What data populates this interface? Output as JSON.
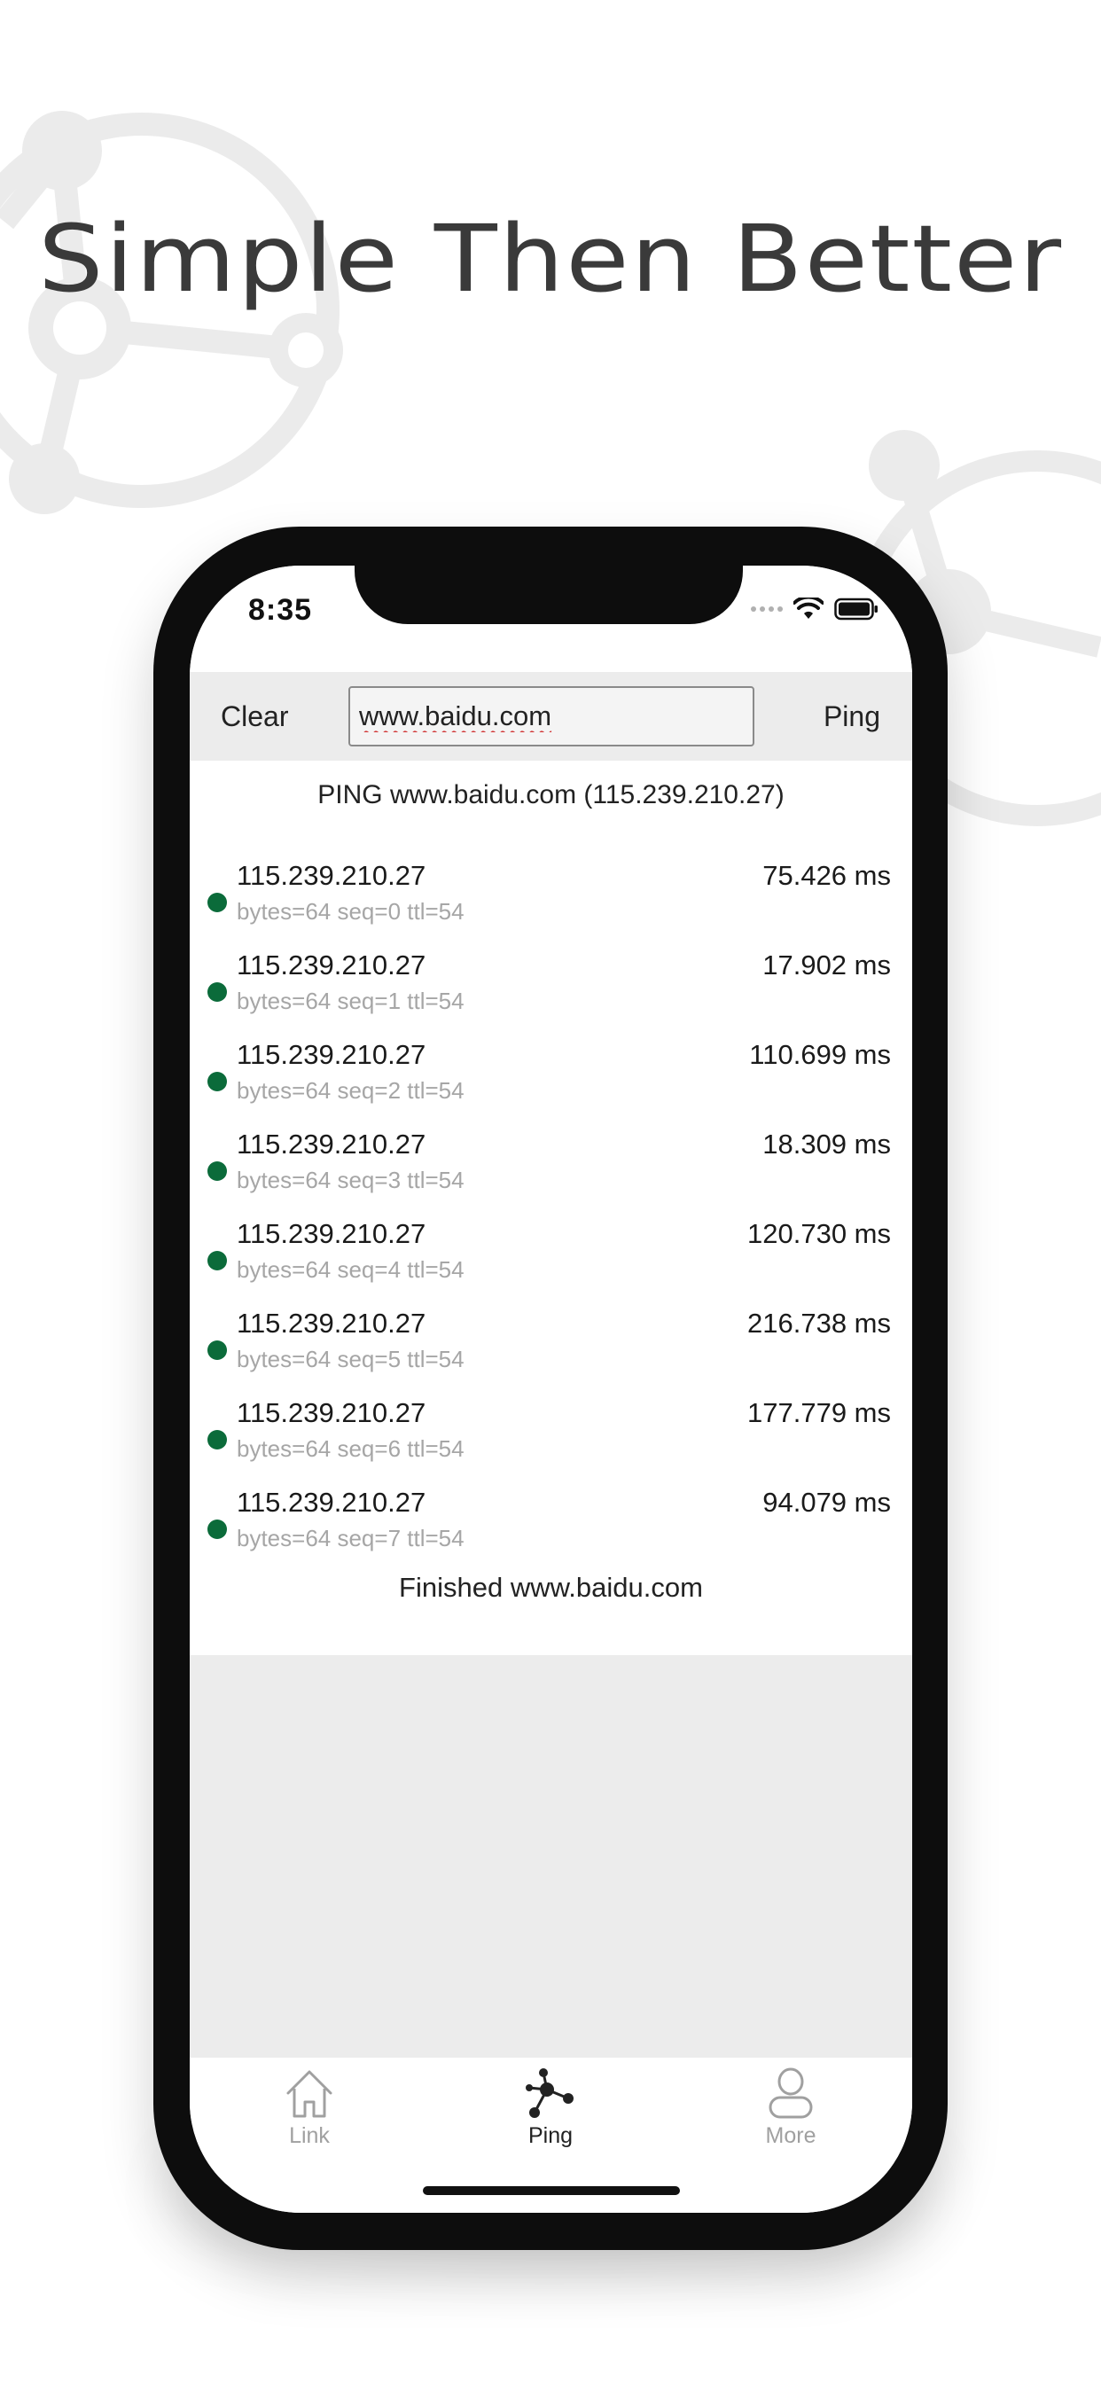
{
  "headline": "Simple Then Better",
  "status_bar": {
    "time": "8:35"
  },
  "toolbar": {
    "clear_label": "Clear",
    "url_value": "www.baidu.com",
    "ping_label": "Ping"
  },
  "ping_header": "PING www.baidu.com (115.239.210.27)",
  "results": [
    {
      "ip": "115.239.210.27",
      "meta": "bytes=64 seq=0 ttl=54",
      "time": "75.426 ms"
    },
    {
      "ip": "115.239.210.27",
      "meta": "bytes=64 seq=1 ttl=54",
      "time": "17.902 ms"
    },
    {
      "ip": "115.239.210.27",
      "meta": "bytes=64 seq=2 ttl=54",
      "time": "110.699 ms"
    },
    {
      "ip": "115.239.210.27",
      "meta": "bytes=64 seq=3 ttl=54",
      "time": "18.309 ms"
    },
    {
      "ip": "115.239.210.27",
      "meta": "bytes=64 seq=4 ttl=54",
      "time": "120.730 ms"
    },
    {
      "ip": "115.239.210.27",
      "meta": "bytes=64 seq=5 ttl=54",
      "time": "216.738 ms"
    },
    {
      "ip": "115.239.210.27",
      "meta": "bytes=64 seq=6 ttl=54",
      "time": "177.779 ms"
    },
    {
      "ip": "115.239.210.27",
      "meta": "bytes=64 seq=7 ttl=54",
      "time": "94.079 ms"
    }
  ],
  "finished": "Finished www.baidu.com",
  "tabbar": {
    "items": [
      {
        "label": "Link",
        "icon": "home-icon",
        "active": false
      },
      {
        "label": "Ping",
        "icon": "network-icon",
        "active": true
      },
      {
        "label": "More",
        "icon": "user-icon",
        "active": false
      }
    ]
  },
  "colors": {
    "status_dot": "#0b6b3a",
    "background_toolbar": "#ececec",
    "headline": "#3a3a3a"
  }
}
